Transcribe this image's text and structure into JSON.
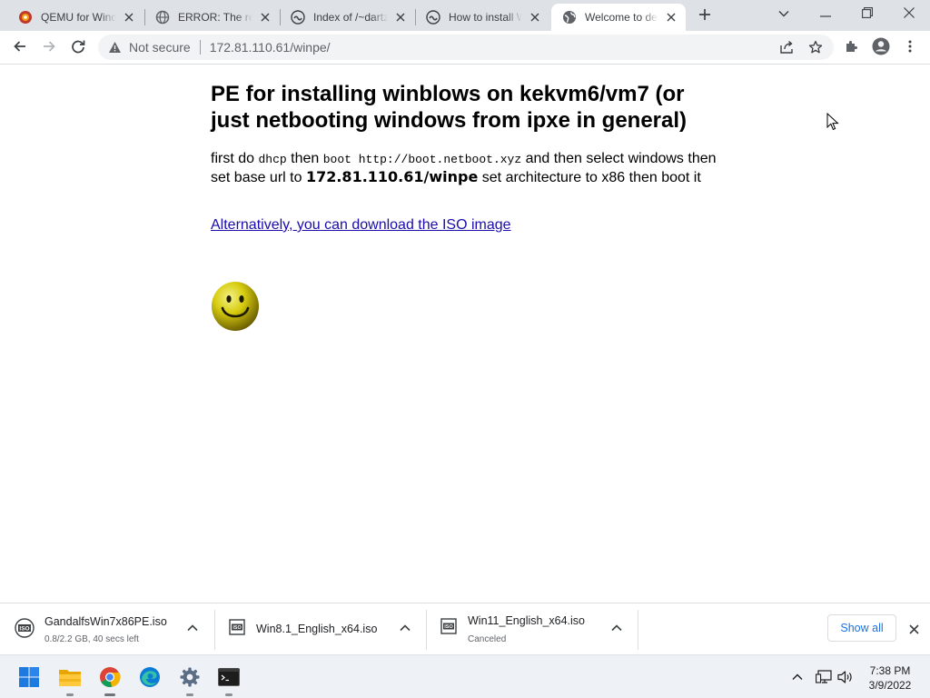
{
  "browser": {
    "tabs": [
      {
        "title": "QEMU for Windows",
        "favicon": "qemu-icon",
        "active": false
      },
      {
        "title": "ERROR: The requested URL could not be retrieved",
        "favicon": "globe-icon",
        "active": false
      },
      {
        "title": "Index of /~dartz",
        "favicon": "tilde-server-icon",
        "active": false
      },
      {
        "title": "How to install Windows",
        "favicon": "tilde-server-icon",
        "active": false
      },
      {
        "title": "Welcome to deb",
        "favicon": "globe-icon",
        "active": true
      }
    ],
    "new_tab_icon": "plus-icon",
    "window_controls": [
      "chevron-down-icon",
      "minimize-icon",
      "restore-icon",
      "close-icon"
    ],
    "toolbar": {
      "security_label": "Not secure",
      "url": "172.81.110.61/winpe/",
      "icons": [
        "back-arrow-icon",
        "forward-arrow-icon",
        "reload-icon",
        "share-icon",
        "star-icon",
        "extensions-puzzle-icon",
        "profile-avatar-icon",
        "more-vert-icon"
      ]
    }
  },
  "page": {
    "heading": "PE for installing winblows on kekvm6/vm7 (or just netbooting windows from ipxe in general)",
    "instructions": {
      "t1": "first do ",
      "c1": "dhcp",
      "t2": " then ",
      "c2": "boot http://boot.netboot.xyz",
      "t3": " and then select windows then set base url to ",
      "b1": "172.81.110.61/winpe",
      "t4": " set architecture to x86 then boot it"
    },
    "iso_link": "Alternatively, you can download the ISO image",
    "image": "smiley-face-icon"
  },
  "downloads": {
    "items": [
      {
        "name": "GandalfsWin7x86PE.iso",
        "status": "0.8/2.2 GB, 40 secs left"
      },
      {
        "name": "Win8.1_English_x64.iso",
        "status": ""
      },
      {
        "name": "Win11_English_x64.iso",
        "status": "Canceled"
      }
    ],
    "show_all": "Show all"
  },
  "taskbar": {
    "apps": [
      "windows-start-icon",
      "file-explorer-icon",
      "chrome-icon",
      "edge-icon",
      "settings-gear-icon",
      "terminal-icon"
    ],
    "tray": [
      "chevron-up-icon",
      "network-icon",
      "volume-icon"
    ],
    "time": "7:38 PM",
    "date": "3/9/2022"
  },
  "colors": {
    "link": "#1a0dab",
    "accent": "#1a73e8",
    "tabstrip_bg": "#dee1e6",
    "taskbar_bg": "#eef1f6"
  }
}
